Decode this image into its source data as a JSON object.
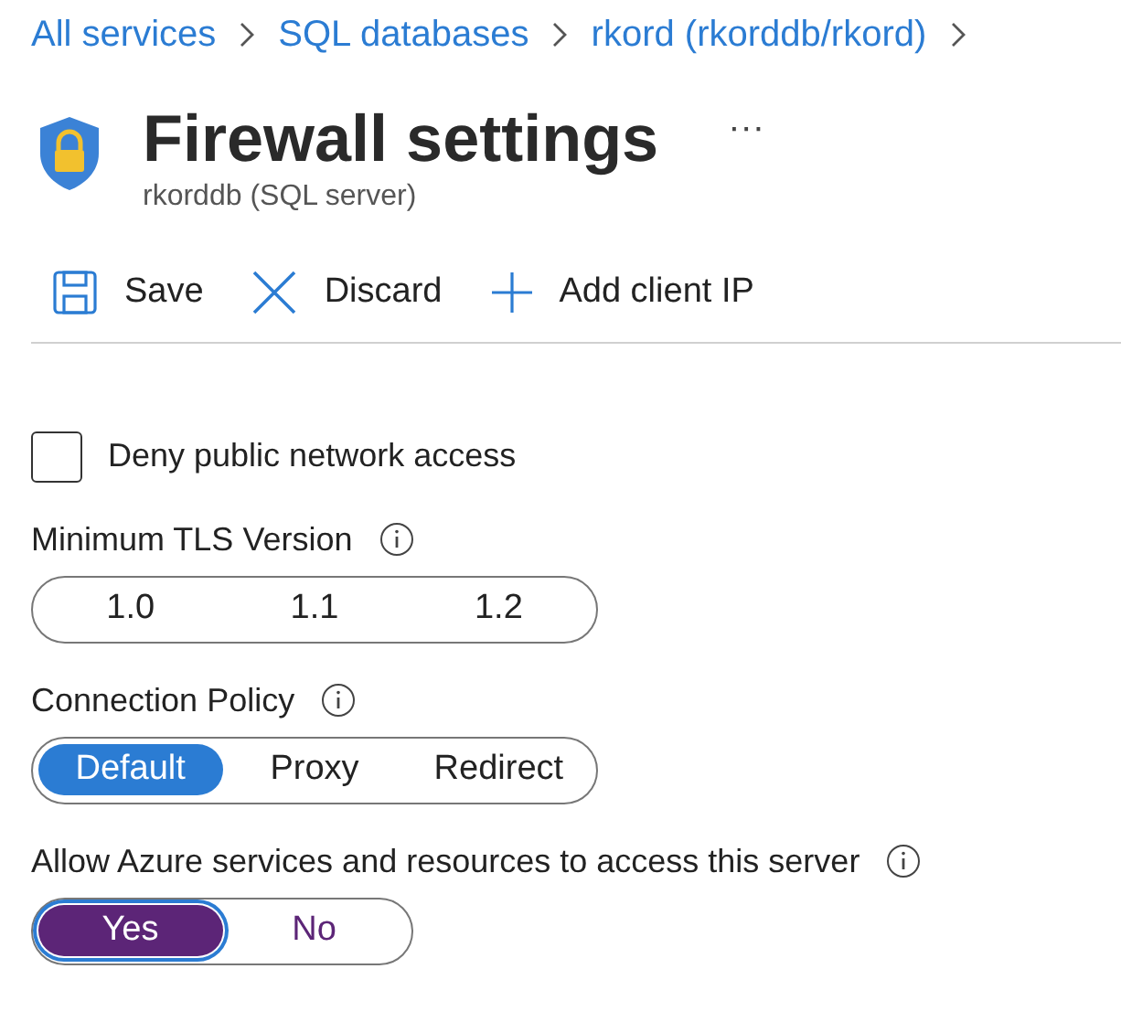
{
  "breadcrumb": [
    "All services",
    "SQL databases",
    "rkord (rkorddb/rkord)"
  ],
  "header": {
    "title": "Firewall settings",
    "more": "···",
    "subtitle": "rkorddb (SQL server)"
  },
  "toolbar": [
    {
      "kind": "save",
      "label": "Save"
    },
    {
      "kind": "discard",
      "label": "Discard"
    },
    {
      "kind": "add",
      "label": "Add client IP"
    }
  ],
  "deny_public_access": {
    "label": "Deny public network access",
    "checked": false
  },
  "settings": [
    {
      "label": "Minimum TLS Version",
      "focused": false,
      "options": [
        {
          "label": "1.0",
          "selected": false
        },
        {
          "label": "1.1",
          "selected": false
        },
        {
          "label": "1.2",
          "selected": false
        }
      ]
    },
    {
      "label": "Connection Policy",
      "focused": false,
      "options": [
        {
          "label": "Default",
          "selected": true
        },
        {
          "label": "Proxy",
          "selected": false
        },
        {
          "label": "Redirect",
          "selected": false
        }
      ]
    },
    {
      "label": "Allow Azure services and resources to access this server",
      "focused": true,
      "options": [
        {
          "label": "Yes",
          "selected": true
        },
        {
          "label": "No",
          "selected": false
        }
      ]
    }
  ]
}
